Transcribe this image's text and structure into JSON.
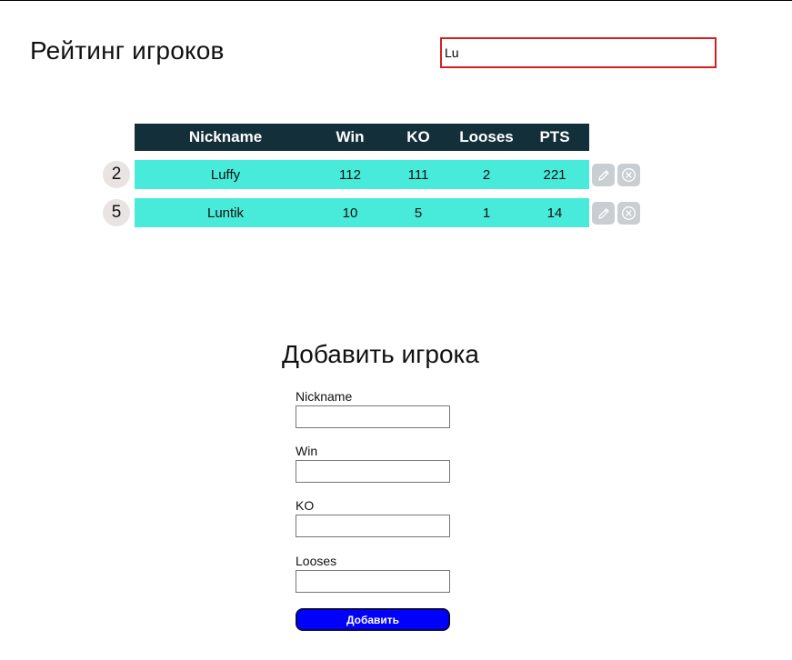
{
  "page": {
    "title": "Рейтинг игроков"
  },
  "search": {
    "value": "Lu",
    "placeholder": ""
  },
  "table": {
    "columns": [
      "Nickname",
      "Win",
      "KO",
      "Looses",
      "PTS"
    ],
    "rows": [
      {
        "rank": "2",
        "nickname": "Luffy",
        "win": "112",
        "ko": "111",
        "looses": "2",
        "pts": "221"
      },
      {
        "rank": "5",
        "nickname": "Luntik",
        "win": "10",
        "ko": "5",
        "looses": "1",
        "pts": "14"
      }
    ]
  },
  "icons": {
    "edit": "pencil-icon",
    "delete": "close-circle-icon"
  },
  "form": {
    "title": "Добавить игрока",
    "fields": [
      {
        "label": "Nickname",
        "value": ""
      },
      {
        "label": "Win",
        "value": ""
      },
      {
        "label": "KO",
        "value": ""
      },
      {
        "label": "Looses",
        "value": ""
      }
    ],
    "submit_label": "Добавить"
  },
  "colors": {
    "header_bg": "#132f3a",
    "row_bg": "#48ead9",
    "search_border": "#d41f1f",
    "submit_bg": "#0000ff",
    "rank_bg": "#e9e4e2",
    "action_bg": "#c9ced3"
  }
}
